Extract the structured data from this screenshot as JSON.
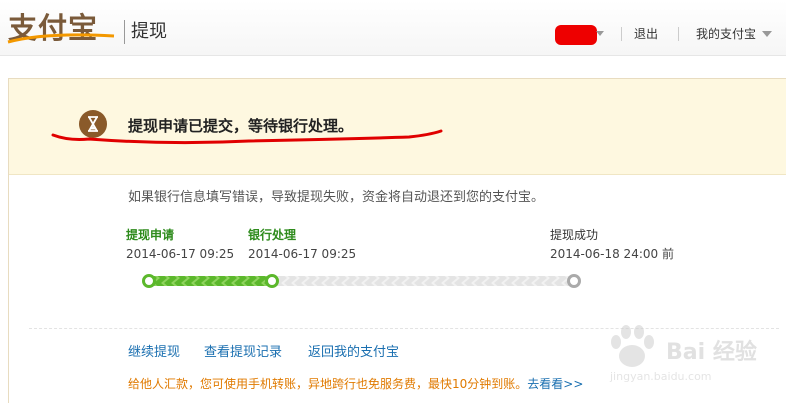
{
  "header": {
    "logo_text": "支付宝",
    "page_name": "提现",
    "logout_label": "退出",
    "my_alipay_label": "我的支付宝"
  },
  "banner": {
    "title": "提现申请已提交，等待银行处理。"
  },
  "note": "如果银行信息填写错误，导致提现失败，资金将自动退还到您的支付宝。",
  "steps": [
    {
      "label": "提现申请",
      "time": "2014-06-17 09:25",
      "state": "done"
    },
    {
      "label": "银行处理",
      "time": "2014-06-17 09:25",
      "state": "done"
    },
    {
      "label": "提现成功",
      "time": "2014-06-18 24:00 前",
      "state": "pending"
    }
  ],
  "links": {
    "continue_withdraw": "继续提现",
    "view_records": "查看提现记录",
    "back_to_alipay": "返回我的支付宝"
  },
  "promo": {
    "text": "给他人汇款，您可使用手机转账，异地跨行也免服务费，最快10分钟到账。",
    "link": "去看看>>"
  },
  "watermark": {
    "text": "Bai 经验",
    "url": "jingyan.baidu.com"
  },
  "colors": {
    "done_green": "#2e8b1c",
    "banner_bg": "#fef8e0",
    "link_blue": "#1a6fb0",
    "promo_orange": "#e07a00",
    "redaction_red": "#ee0000"
  }
}
